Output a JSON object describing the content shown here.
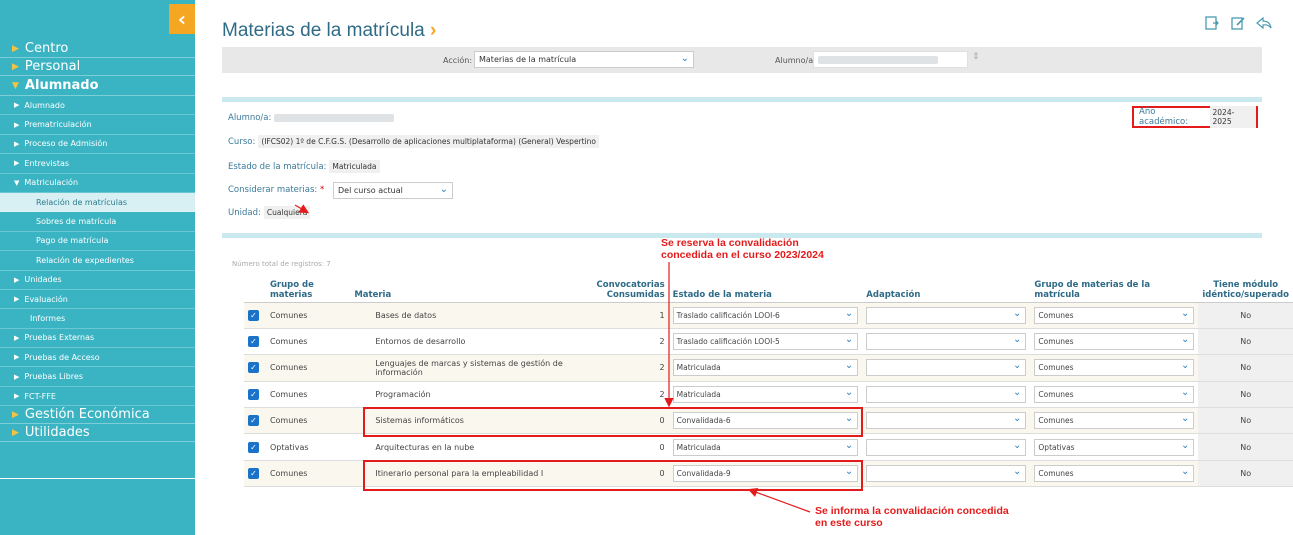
{
  "sidebar": {
    "collapse_icon": "chevron-left-icon",
    "sections": [
      {
        "label": "Centro"
      },
      {
        "label": "Personal"
      }
    ],
    "active_section": {
      "label": "Alumnado"
    },
    "sub": [
      {
        "label": "Alumnado"
      },
      {
        "label": "Prematriculación"
      },
      {
        "label": "Proceso de Admisión"
      },
      {
        "label": "Entrevistas"
      },
      {
        "label": "Matriculación"
      }
    ],
    "sub3": [
      {
        "label": "Relación de matrículas"
      },
      {
        "label": "Sobres de matrícula"
      },
      {
        "label": "Pago de matrícula"
      },
      {
        "label": "Relación de expedientes"
      }
    ],
    "sub_after": [
      {
        "label": "Unidades"
      },
      {
        "label": "Evaluación"
      },
      {
        "label": "Informes"
      },
      {
        "label": "Pruebas Externas"
      },
      {
        "label": "Pruebas de Acceso"
      },
      {
        "label": "Pruebas Libres"
      },
      {
        "label": "FCT-FFE"
      }
    ],
    "sections_after": [
      {
        "label": "Gestión Económica"
      },
      {
        "label": "Utilidades"
      }
    ]
  },
  "header": {
    "title": "Materias de la matrícula",
    "title_chevron": "›",
    "icons": [
      "save-icon",
      "edit-icon",
      "back-icon"
    ]
  },
  "filter": {
    "accion_label": "Acción:",
    "accion_value": "Materias de la matrícula",
    "alumno_label": "Alumno/a:"
  },
  "info": {
    "alumno_label": "Alumno/a:",
    "curso_label": "Curso:",
    "curso_value": "(IFCS02) 1º de C.F.G.S. (Desarrollo de aplicaciones multiplataforma) (General) Vespertino",
    "estado_label": "Estado de la matrícula:",
    "estado_value": "Matriculada",
    "considerar_label": "Considerar materias:",
    "considerar_req": "*",
    "considerar_value": "Del curso actual",
    "unidad_label": "Unidad:",
    "unidad_value": "Cualquiera",
    "ano_label": "Año académico:",
    "ano_value": "2024-2025"
  },
  "table": {
    "count_text": "Número total de registros: 7",
    "headers": {
      "grupo": "Grupo de materias",
      "materia": "Materia",
      "conv": "Convocatorias Consumidas",
      "estado": "Estado de la materia",
      "adapt": "Adaptación",
      "grupo_mat": "Grupo de materias de la matrícula",
      "tiene": "Tiene módulo idéntico/superado"
    },
    "rows": [
      {
        "grupo": "Comunes",
        "materia": "Bases de datos",
        "conv": "1",
        "estado": "Traslado calificación LOOI-6",
        "adapt": "",
        "grupo_mat": "Comunes",
        "tiene": "No"
      },
      {
        "grupo": "Comunes",
        "materia": "Entornos de desarrollo",
        "conv": "2",
        "estado": "Traslado calificación LOOI-5",
        "adapt": "",
        "grupo_mat": "Comunes",
        "tiene": "No"
      },
      {
        "grupo": "Comunes",
        "materia": "Lenguajes de marcas y sistemas de gestión de información",
        "conv": "2",
        "estado": "Matriculada",
        "adapt": "",
        "grupo_mat": "Comunes",
        "tiene": "No"
      },
      {
        "grupo": "Comunes",
        "materia": "Programación",
        "conv": "2",
        "estado": "Matriculada",
        "adapt": "",
        "grupo_mat": "Comunes",
        "tiene": "No"
      },
      {
        "grupo": "Comunes",
        "materia": "Sistemas informáticos",
        "conv": "0",
        "estado": "Convalidada-6",
        "adapt": "",
        "grupo_mat": "Comunes",
        "tiene": "No"
      },
      {
        "grupo": "Optativas",
        "materia": "Arquitecturas en la nube",
        "conv": "0",
        "estado": "Matriculada",
        "adapt": "",
        "grupo_mat": "Optativas",
        "tiene": "No"
      },
      {
        "grupo": "Comunes",
        "materia": "Itinerario personal para la empleabilidad I",
        "conv": "0",
        "estado": "Convalidada-9",
        "adapt": "",
        "grupo_mat": "Comunes",
        "tiene": "No"
      }
    ]
  },
  "annotations": {
    "top_line1": "Se reserva la convalidación",
    "top_line2": "concedida en el curso 2023/2024",
    "bottom_line1": "Se informa la convalidación concedida",
    "bottom_line2": "en este curso"
  },
  "colors": {
    "sidebar": "#3ab4c3",
    "accent": "#f5a623",
    "highlight": "#e41b1b",
    "title": "#2f6b87"
  }
}
